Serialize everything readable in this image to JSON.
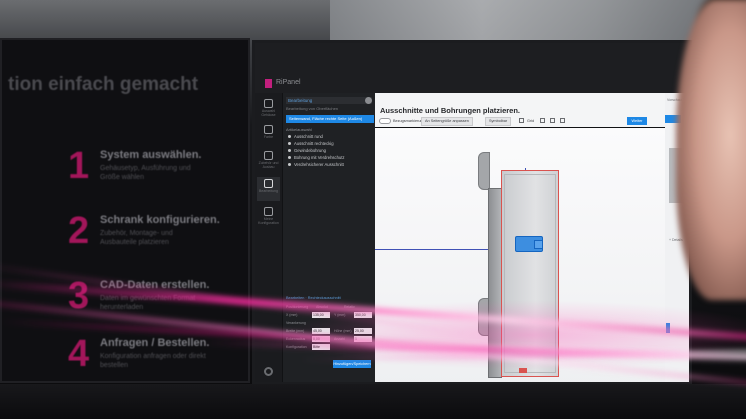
{
  "left_monitor": {
    "title": "tion einfach gemacht",
    "steps": [
      {
        "num": "1",
        "title": "System auswählen.",
        "desc": "Gehäusetyp, Ausführung und Größe wählen"
      },
      {
        "num": "2",
        "title": "Schrank konfigurieren.",
        "desc": "Zubehör, Montage- und Ausbauteile platzieren"
      },
      {
        "num": "3",
        "title": "CAD-Daten erstellen.",
        "desc": "Daten im gewünschten Format herunterladen"
      },
      {
        "num": "4",
        "title": "Anfragen / Bestellen.",
        "desc": "Konfiguration anfragen oder direkt bestellen"
      }
    ]
  },
  "app": {
    "name": "RiPanel",
    "rail": [
      {
        "label": "Auswahl Gehäuse",
        "icon": "cube-icon"
      },
      {
        "label": "Farbe",
        "icon": "palette-icon"
      },
      {
        "label": "Zubehör und Ausbau",
        "icon": "layers-icon"
      },
      {
        "label": "Bearbeitung",
        "icon": "drill-icon"
      },
      {
        "label": "Meine Konfiguration",
        "icon": "document-icon"
      }
    ],
    "panel": {
      "header": "Bearbeitung",
      "subheader": "Bearbeitung von Oberflächen",
      "selected_surface": "Seitenwand, Fläche rechte Seite (Außen)",
      "section_label": "Artikelauswahl",
      "options": [
        "Ausschnitt rund",
        "Ausschnitt rechteckig",
        "Gewindebohrung",
        "Bohrung mit Verdrehschutz",
        "Verdrehsicherer Ausschnitt"
      ],
      "form_header": "Bearbeiten · Rechteckausschnitt",
      "form_rows": [
        {
          "label": "Positionierung",
          "value": "Absolut",
          "label2": "Relativ",
          "value2": ""
        },
        {
          "label": "X (mm)",
          "value": "135,00",
          "label2": "Y (mm)",
          "value2": "350,00"
        },
        {
          "label": "Verankerung",
          "value": "",
          "label2": "",
          "value2": ""
        },
        {
          "label": "Breite (mm)",
          "value": "45,00",
          "label2": "Höhe (mm)",
          "value2": "25,00"
        },
        {
          "label": "Eckenradius",
          "value": "0,00",
          "label2": "Anzahl",
          "value2": "1"
        },
        {
          "label": "Konfiguration",
          "value": "Bitte",
          "label2": "",
          "value2": ""
        }
      ],
      "apply_button": "Hinzufügen/Speichern"
    },
    "canvas": {
      "title": "Ausschnitte und Bohrungen platzieren.",
      "toggle_label": "Bezugsmarkierung",
      "fit_button": "An Seitengröße anpassen",
      "view_button": "Symbolbar",
      "grid_label": "Grid",
      "primary_button": "Weiter"
    },
    "side_panel": {
      "label": "Vorschau",
      "small": "+ Details"
    }
  }
}
